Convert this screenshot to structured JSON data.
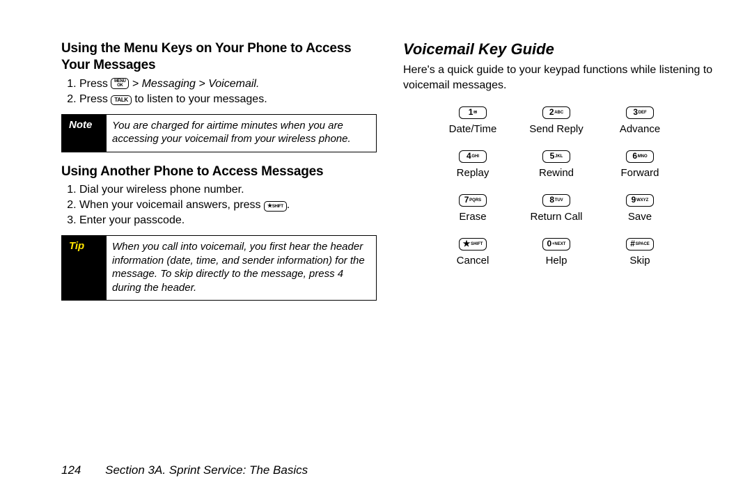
{
  "left": {
    "h1": "Using the Menu Keys on Your Phone to Access Your Messages",
    "step1_prefix": "Press ",
    "step1_keycap_top": "MENU",
    "step1_keycap_bot": "OK",
    "step1_path": " > Messaging > Voicemail.",
    "step2_prefix": "Press ",
    "step2_keycap": "TALK",
    "step2_suffix": " to listen to your messages.",
    "note_label": "Note",
    "note_text": "You are charged for airtime minutes when you are accessing your voicemail from your wireless phone.",
    "h2": "Using Another Phone to Access Messages",
    "b_step1": "Dial your wireless phone number.",
    "b_step2_prefix": "When your voicemail answers, press ",
    "b_step2_keycap_star": "★",
    "b_step2_keycap_small": "SHIFT",
    "b_step2_suffix": ".",
    "b_step3": "Enter your passcode.",
    "tip_label": "Tip",
    "tip_text": "When you call into voicemail, you first hear the header information (date, time, and sender information) for the message. To skip directly to the message, press 4 during the header."
  },
  "right": {
    "heading": "Voicemail Key Guide",
    "intro": "Here's a quick guide to your keypad functions while listening to voicemail messages.",
    "keys": [
      {
        "big": "1",
        "small": "✉",
        "label": "Date/Time"
      },
      {
        "big": "2",
        "small": "ABC",
        "label": "Send Reply"
      },
      {
        "big": "3",
        "small": "DEF",
        "label": "Advance"
      },
      {
        "big": "4",
        "small": "GHI",
        "label": "Replay"
      },
      {
        "big": "5",
        "small": "JKL",
        "label": "Rewind"
      },
      {
        "big": "6",
        "small": "MNO",
        "label": "Forward"
      },
      {
        "big": "7",
        "small": "PQRS",
        "label": "Erase"
      },
      {
        "big": "8",
        "small": "TUV",
        "label": "Return Call"
      },
      {
        "big": "9",
        "small": "WXYZ",
        "label": "Save"
      },
      {
        "big": "★",
        "small": "SHIFT",
        "label": "Cancel"
      },
      {
        "big": "0",
        "small": "+NEXT",
        "label": "Help"
      },
      {
        "big": "#",
        "small": "SPACE",
        "label": "Skip"
      }
    ]
  },
  "footer": {
    "page": "124",
    "section": "Section 3A. Sprint Service: The Basics"
  }
}
